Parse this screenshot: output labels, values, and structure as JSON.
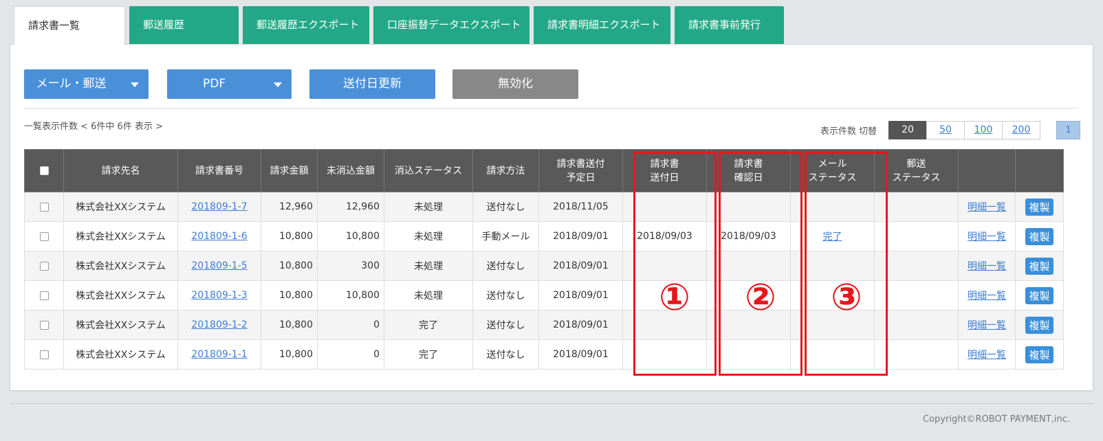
{
  "tabs": [
    "請求書一覧",
    "郵送履歴",
    "郵送履歴エクスポート",
    "口座振替データエクスポート",
    "請求書明細エクスポート",
    "請求書事前発行"
  ],
  "toolbar": {
    "mail_post": "メール・郵送",
    "pdf": "PDF",
    "update_send_date": "送付日更新",
    "invalidate": "無効化"
  },
  "list_info": "一覧表示件数 < 6件中 6件 表示 >",
  "perpage_label": "表示件数 切替",
  "perpage_options": [
    "20",
    "50",
    "100",
    "200"
  ],
  "page_current": "1",
  "columns": {
    "client": "請求先名",
    "number": "請求書番号",
    "amount": "請求金額",
    "unpaid": "未消込金額",
    "status": "消込ステータス",
    "method": "請求方法",
    "scheduled_1": "請求書送付",
    "scheduled_2": "予定日",
    "sent_1": "請求書",
    "sent_2": "送付日",
    "confirmed_1": "請求書",
    "confirmed_2": "確認日",
    "mail_status_1": "メール",
    "mail_status_2": "ステータス",
    "post_status_1": "郵送",
    "post_status_2": "ステータス"
  },
  "rows": [
    {
      "client": "株式会社XXシステム",
      "number": "201809-1-7",
      "amount": "12,960",
      "unpaid": "12,960",
      "status": "未処理",
      "method": "送付なし",
      "scheduled": "2018/11/05",
      "sent": "",
      "confirmed": "",
      "mail_status": "",
      "post_status": "",
      "detail": "明細一覧",
      "copy": "複製"
    },
    {
      "client": "株式会社XXシステム",
      "number": "201809-1-6",
      "amount": "10,800",
      "unpaid": "10,800",
      "status": "未処理",
      "method": "手動メール",
      "scheduled": "2018/09/01",
      "sent": "2018/09/03",
      "confirmed": "2018/09/03",
      "mail_status": "完了",
      "post_status": "",
      "detail": "明細一覧",
      "copy": "複製"
    },
    {
      "client": "株式会社XXシステム",
      "number": "201809-1-5",
      "amount": "10,800",
      "unpaid": "300",
      "status": "未処理",
      "method": "送付なし",
      "scheduled": "2018/09/01",
      "sent": "",
      "confirmed": "",
      "mail_status": "",
      "post_status": "",
      "detail": "明細一覧",
      "copy": "複製"
    },
    {
      "client": "株式会社XXシステム",
      "number": "201809-1-3",
      "amount": "10,800",
      "unpaid": "10,800",
      "status": "未処理",
      "method": "送付なし",
      "scheduled": "2018/09/01",
      "sent": "",
      "confirmed": "",
      "mail_status": "",
      "post_status": "",
      "detail": "明細一覧",
      "copy": "複製"
    },
    {
      "client": "株式会社XXシステム",
      "number": "201809-1-2",
      "amount": "10,800",
      "unpaid": "0",
      "status": "完了",
      "method": "送付なし",
      "scheduled": "2018/09/01",
      "sent": "",
      "confirmed": "",
      "mail_status": "",
      "post_status": "",
      "detail": "明細一覧",
      "copy": "複製"
    },
    {
      "client": "株式会社XXシステム",
      "number": "201809-1-1",
      "amount": "10,800",
      "unpaid": "0",
      "status": "完了",
      "method": "送付なし",
      "scheduled": "2018/09/01",
      "sent": "",
      "confirmed": "",
      "mail_status": "",
      "post_status": "",
      "detail": "明細一覧",
      "copy": "複製"
    }
  ],
  "annotations": [
    "①",
    "②",
    "③"
  ],
  "annotation_color": "#e5181e",
  "copyright": "Copyright©ROBOT PAYMENT,inc."
}
